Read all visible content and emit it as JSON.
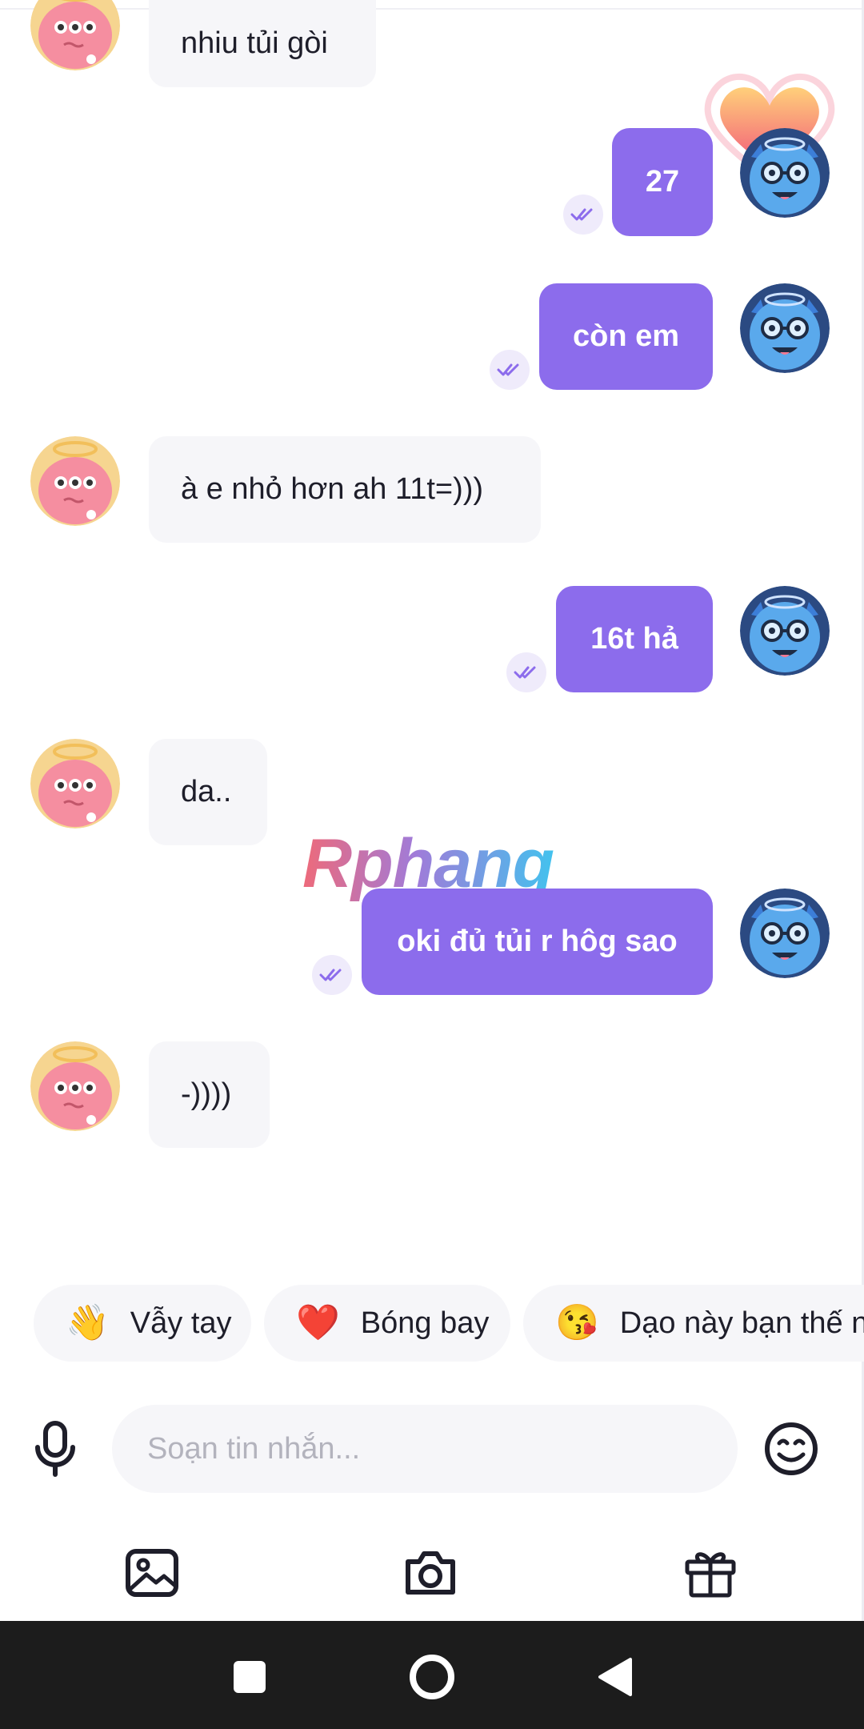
{
  "colors": {
    "accent": "#8c6cec",
    "incoming_bubble": "#f6f6f9",
    "navbar": "#1c1c1c"
  },
  "watermark": "Rphang",
  "messages": [
    {
      "side": "in",
      "text": "nhiu tủi gòi"
    },
    {
      "side": "out",
      "text": "27",
      "read": true
    },
    {
      "side": "out",
      "text": "còn em",
      "read": true
    },
    {
      "side": "in",
      "text": "à e nhỏ hơn ah 11t=)))"
    },
    {
      "side": "out",
      "text": "16t hả",
      "read": true
    },
    {
      "side": "in",
      "text": "da.."
    },
    {
      "side": "out",
      "text": "oki đủ tủi r hôg sao",
      "read": true
    },
    {
      "side": "in",
      "text": "-))))"
    }
  ],
  "quick_replies": [
    {
      "emoji": "👋",
      "label": "Vẫy tay"
    },
    {
      "emoji": "❤️",
      "label": "Bóng bay"
    },
    {
      "emoji": "😘",
      "label": "Dạo này bạn thế n"
    }
  ],
  "composer": {
    "placeholder": "Soạn tin nhắn...",
    "left_icon": "microphone-icon",
    "right_icon": "emoji-icon"
  },
  "toolbar_icons": [
    "image-icon",
    "camera-icon",
    "gift-icon"
  ],
  "nav_icons": [
    "recents-square-icon",
    "home-circle-icon",
    "back-triangle-icon"
  ]
}
